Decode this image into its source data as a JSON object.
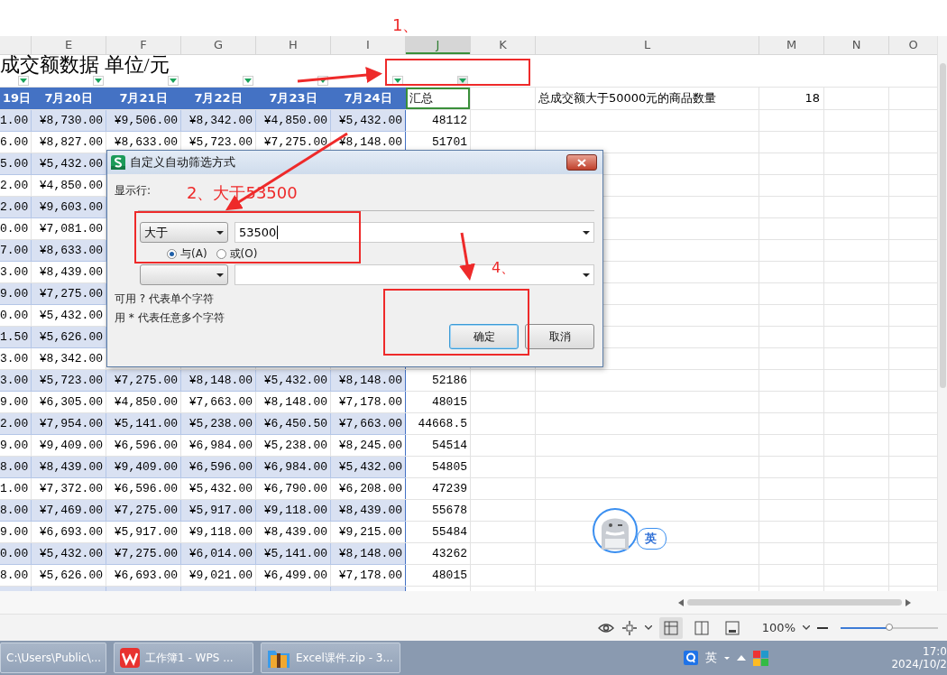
{
  "sheet": {
    "title": "成交额数据 单位/元",
    "columns": [
      {
        "header": "19日",
        "kind": "date",
        "filter": true
      },
      {
        "letter": "E",
        "header": "7月20日",
        "kind": "date",
        "filter": true
      },
      {
        "letter": "F",
        "header": "7月21日",
        "kind": "date",
        "filter": true
      },
      {
        "letter": "G",
        "header": "7月22日",
        "kind": "date",
        "filter": true
      },
      {
        "letter": "H",
        "header": "7月23日",
        "kind": "date",
        "filter": true
      },
      {
        "letter": "I",
        "header": "7月24日",
        "kind": "date",
        "filter": true
      },
      {
        "letter": "J",
        "header": "汇总",
        "kind": "total",
        "filter": true,
        "selected": true
      },
      {
        "letter": "K",
        "selected": false
      },
      {
        "letter": "L",
        "header": "总成交额大于50000元的商品数量",
        "kind": "text",
        "selected": false
      },
      {
        "letter": "M",
        "header": "18",
        "kind": "number",
        "selected": false
      },
      {
        "letter": "N",
        "selected": false
      },
      {
        "letter": "O",
        "selected": false
      }
    ],
    "rows": [
      {
        "cells": [
          "1.00",
          "¥8,730.00",
          "¥9,506.00",
          "¥8,342.00",
          "¥4,850.00",
          "¥5,432.00",
          "48112"
        ]
      },
      {
        "cells": [
          "6.00",
          "¥8,827.00",
          "¥8,633.00",
          "¥5,723.00",
          "¥7,275.00",
          "¥8,148.00",
          "51701"
        ]
      },
      {
        "cells": [
          "5.00",
          "¥5,432.00"
        ]
      },
      {
        "cells": [
          "2.00",
          "¥4,850.00"
        ]
      },
      {
        "cells": [
          "2.00",
          "¥9,603.00"
        ]
      },
      {
        "cells": [
          "0.00",
          "¥7,081.00"
        ]
      },
      {
        "cells": [
          "7.00",
          "¥8,633.00"
        ]
      },
      {
        "cells": [
          "3.00",
          "¥8,439.00"
        ]
      },
      {
        "cells": [
          "9.00",
          "¥7,275.00"
        ]
      },
      {
        "cells": [
          "0.00",
          "¥5,432.00"
        ]
      },
      {
        "cells": [
          "1.50",
          "¥5,626.00"
        ]
      },
      {
        "cells": [
          "3.00",
          "¥8,342.00"
        ]
      },
      {
        "cells": [
          "3.00",
          "¥5,723.00",
          "¥7,275.00",
          "¥8,148.00",
          "¥5,432.00",
          "¥8,148.00",
          "52186"
        ]
      },
      {
        "cells": [
          "9.00",
          "¥6,305.00",
          "¥4,850.00",
          "¥7,663.00",
          "¥8,148.00",
          "¥7,178.00",
          "48015"
        ]
      },
      {
        "cells": [
          "2.00",
          "¥7,954.00",
          "¥5,141.00",
          "¥5,238.00",
          "¥6,450.50",
          "¥7,663.00",
          "44668.5"
        ]
      },
      {
        "cells": [
          "9.00",
          "¥9,409.00",
          "¥6,596.00",
          "¥6,984.00",
          "¥5,238.00",
          "¥8,245.00",
          "54514"
        ]
      },
      {
        "cells": [
          "8.00",
          "¥8,439.00",
          "¥9,409.00",
          "¥6,596.00",
          "¥6,984.00",
          "¥5,432.00",
          "54805"
        ]
      },
      {
        "cells": [
          "1.00",
          "¥7,372.00",
          "¥6,596.00",
          "¥5,432.00",
          "¥6,790.00",
          "¥6,208.00",
          "47239"
        ]
      },
      {
        "cells": [
          "8.00",
          "¥7,469.00",
          "¥7,275.00",
          "¥5,917.00",
          "¥9,118.00",
          "¥8,439.00",
          "55678"
        ]
      },
      {
        "cells": [
          "9.00",
          "¥6,693.00",
          "¥5,917.00",
          "¥9,118.00",
          "¥8,439.00",
          "¥9,215.00",
          "55484"
        ]
      },
      {
        "cells": [
          "0.00",
          "¥5,432.00",
          "¥7,275.00",
          "¥6,014.00",
          "¥5,141.00",
          "¥8,148.00",
          "43262"
        ]
      },
      {
        "cells": [
          "8.00",
          "¥5,626.00",
          "¥6,693.00",
          "¥9,021.00",
          "¥6,499.00",
          "¥7,178.00",
          "48015"
        ]
      }
    ]
  },
  "dialog": {
    "title": "自定义自动筛选方式",
    "show_rows_label": "显示行:",
    "condition": {
      "operator": "大于",
      "value": "53500"
    },
    "logic": [
      {
        "label": "与(A)",
        "selected": true
      },
      {
        "label": "或(O)",
        "selected": false
      }
    ],
    "hints": [
      "可用 ? 代表单个字符",
      "用 * 代表任意多个字符"
    ],
    "buttons": [
      {
        "label": "确定",
        "focused": true
      },
      {
        "label": "取消",
        "focused": false
      }
    ]
  },
  "annotations": [
    {
      "text": "1、"
    },
    {
      "text": "2、大于53500"
    },
    {
      "text": "4、"
    }
  ],
  "ime_widget": {
    "label": "英"
  },
  "status_bar": {
    "view_modes": [
      {
        "kind": "normal",
        "selected": true
      },
      {
        "kind": "split",
        "selected": false
      },
      {
        "kind": "page",
        "selected": false
      }
    ],
    "zoom": {
      "reading": "100%",
      "level": 0.5
    }
  },
  "taskbar": {
    "tasks": [
      {
        "kind": "explorer",
        "label": "C:\\Users\\Public\\..."
      },
      {
        "kind": "wps",
        "label": "工作簿1 - WPS ..."
      },
      {
        "kind": "archive",
        "label": "Excel课件.zip - 3..."
      }
    ],
    "tray": {
      "ime": "英",
      "time": "17:0",
      "date": "2024/10/2"
    }
  }
}
